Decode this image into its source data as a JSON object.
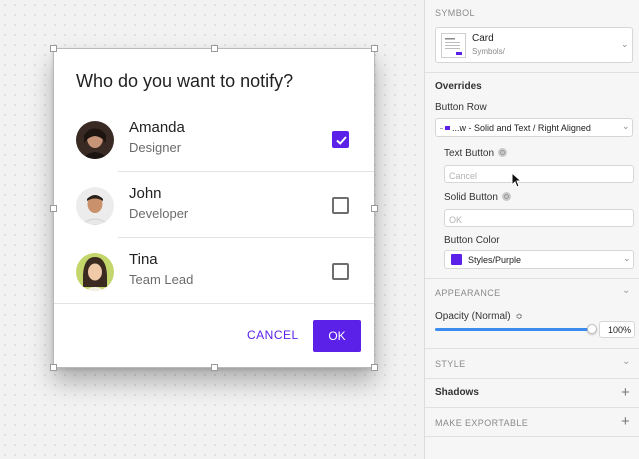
{
  "dialog": {
    "title": "Who do you want to notify?",
    "people": [
      {
        "name": "Amanda",
        "role": "Designer",
        "checked": true
      },
      {
        "name": "John",
        "role": "Developer",
        "checked": false
      },
      {
        "name": "Tina",
        "role": "Team Lead",
        "checked": false
      }
    ],
    "cancel_label": "CANCEL",
    "ok_label": "OK"
  },
  "inspector": {
    "symbol_header": "SYMBOL",
    "symbol_name": "Card",
    "symbol_path": "Symbols/",
    "overrides_header": "Overrides",
    "button_row_label": "Button Row",
    "button_row_value": "...w - Solid and Text / Right Aligned",
    "text_button_label": "Text Button",
    "text_button_placeholder": "Cancel",
    "solid_button_label": "Solid Button",
    "solid_button_placeholder": "OK",
    "button_color_label": "Button Color",
    "button_color_value": "Styles/Purple",
    "button_color_swatch": "#5b21e8",
    "appearance_header": "APPEARANCE",
    "opacity_label": "Opacity (Normal)",
    "opacity_value": "100%",
    "opacity_fraction": 1.0,
    "style_header": "STYLE",
    "shadows_label": "Shadows",
    "exportable_header": "MAKE EXPORTABLE"
  },
  "colors": {
    "accent": "#5b21e8"
  }
}
